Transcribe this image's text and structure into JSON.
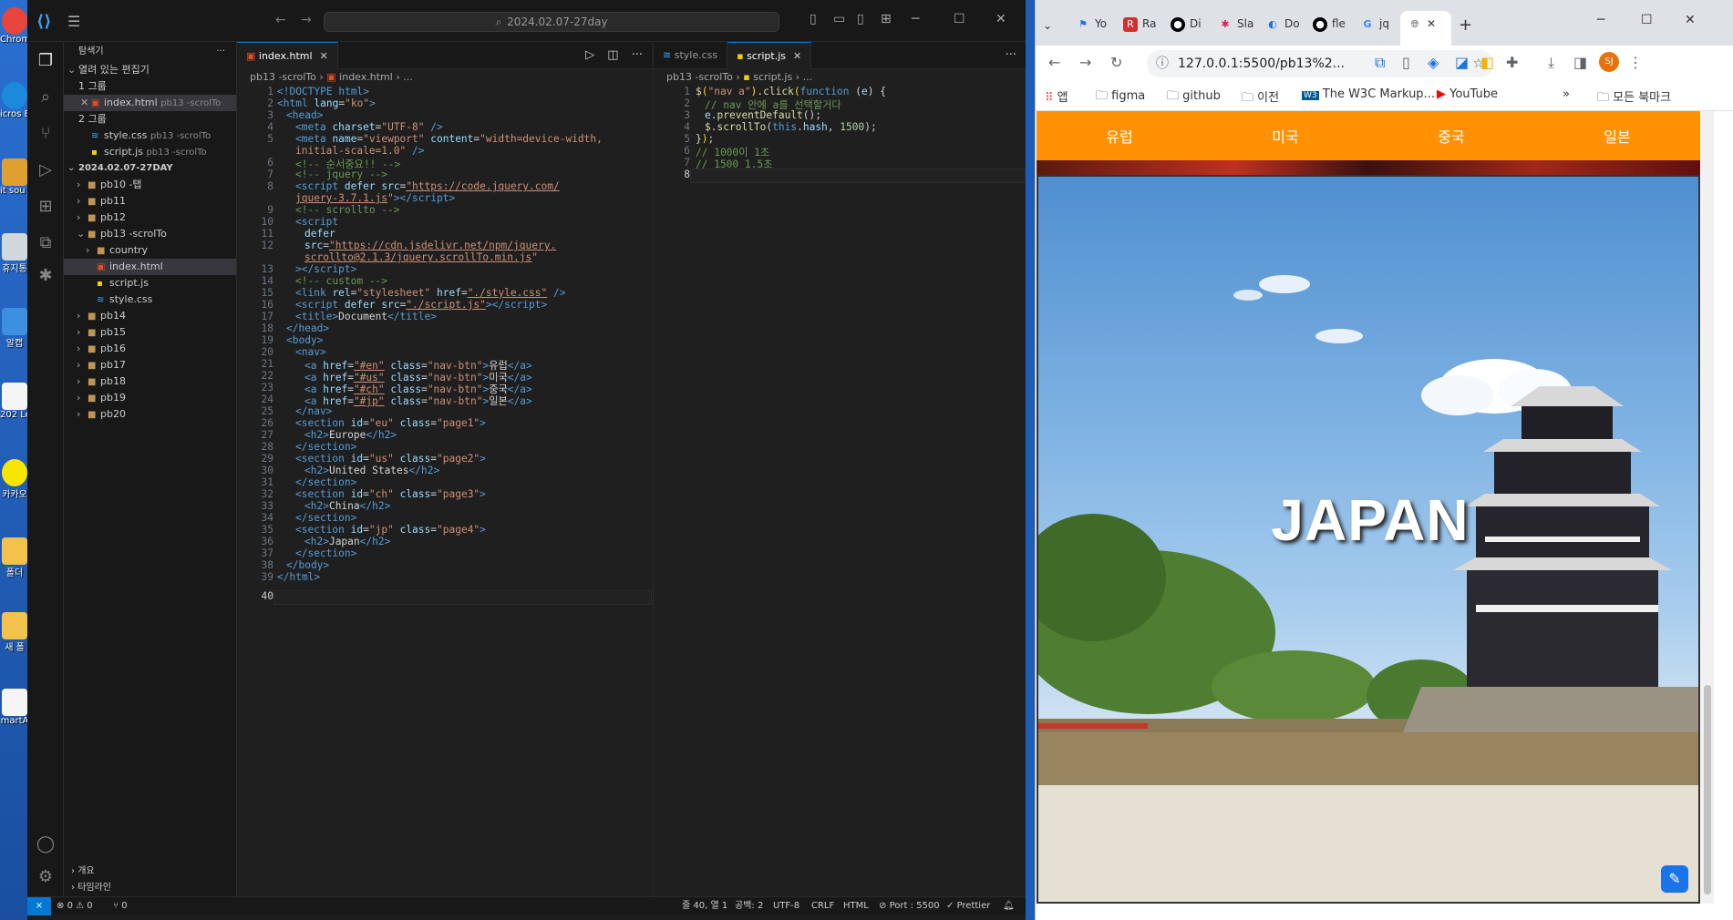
{
  "desktop": {
    "icons": [
      {
        "label": "Chrom",
        "color": "#e8453c"
      },
      {
        "label": "icros Edge",
        "color": "#1c8adb"
      },
      {
        "label": "it sou parta",
        "color": "#e0a030"
      },
      {
        "label": "휴지통",
        "color": "#cfd8dc"
      },
      {
        "label": "알캡",
        "color": "#3d8fe0"
      },
      {
        "label": "202 Lep",
        "color": "#f5f5f5"
      },
      {
        "label": "카카오",
        "color": "#f7e600"
      },
      {
        "label": "폴더",
        "color": "#f2c24a"
      },
      {
        "label": "새 폴",
        "color": "#f2c24a"
      },
      {
        "label": "martA",
        "color": "#f5f5f5"
      }
    ]
  },
  "vscode": {
    "title": "2024.02.07-27day",
    "explorer_title": "탐색기",
    "open_editors_label": "열려 있는 편집기",
    "group1": "1 그룹",
    "group2": "2 그룹",
    "open_editors": [
      {
        "name": "index.html",
        "path": "pb13 -scrolTo"
      },
      {
        "name": "style.css",
        "path": "pb13 -scrolTo"
      },
      {
        "name": "script.js",
        "path": "pb13 -scrolTo"
      }
    ],
    "workspace_label": "2024.02.07-27DAY",
    "tree": [
      "pb10 -탭",
      "pb11",
      "pb12",
      "pb13 -scrolTo",
      "country",
      "index.html",
      "script.js",
      "style.css",
      "pb14",
      "pb15",
      "pb16",
      "pb17",
      "pb18",
      "pb19",
      "pb20"
    ],
    "outline_label": "개요",
    "timeline_label": "타임라인",
    "left_tab": "index.html",
    "left_crumb": [
      "pb13 -scrolTo",
      "index.html",
      "..."
    ],
    "right_tabs": [
      "style.css",
      "script.js"
    ],
    "right_crumb": [
      "pb13 -scrolTo",
      "script.js",
      "..."
    ],
    "status": {
      "errors": "0",
      "warnings": "0",
      "ports": "0",
      "position": "줄 40, 열 1",
      "spaces": "공백: 2",
      "encoding": "UTF-8",
      "eol": "CRLF",
      "language": "HTML",
      "port": "Port : 5500",
      "prettier": "Prettier"
    }
  },
  "chrome": {
    "tabs": [
      "Yo",
      "Ra",
      "Di",
      "Sla",
      "Do",
      "fle",
      "jq"
    ],
    "url": "127.0.0.1:5500/pb13%2...",
    "profile": "SJ",
    "bookmarks": [
      "앱",
      "figma",
      "github",
      "이전",
      "The W3C Markup...",
      "YouTube",
      "모든 북마크"
    ],
    "nav": [
      "유럽",
      "미국",
      "중국",
      "일본"
    ],
    "hero_text": "JAPAN"
  }
}
